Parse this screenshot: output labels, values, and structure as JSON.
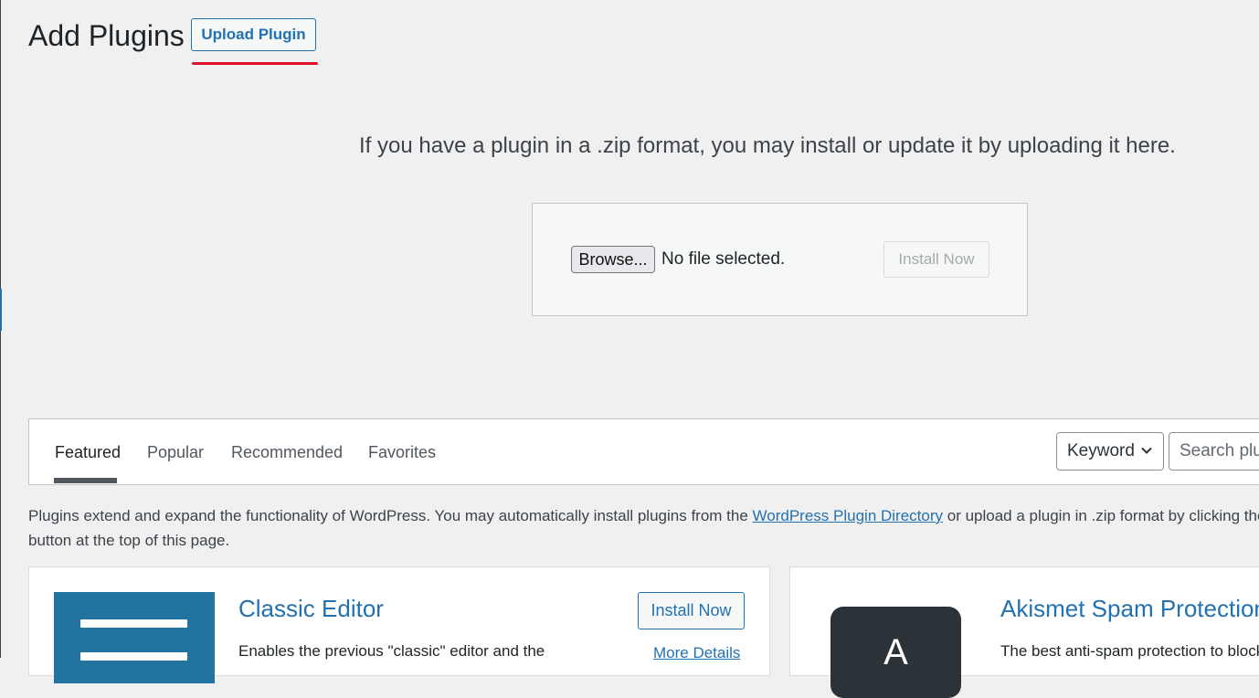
{
  "header": {
    "title": "Add Plugins",
    "upload_button": "Upload Plugin"
  },
  "upload": {
    "help_text": "If you have a plugin in a .zip format, you may install or update it by uploading it here.",
    "browse_button": "Browse...",
    "file_status": "No file selected.",
    "install_button": "Install Now"
  },
  "filter": {
    "tabs": [
      {
        "label": "Featured",
        "active": true
      },
      {
        "label": "Popular",
        "active": false
      },
      {
        "label": "Recommended",
        "active": false
      },
      {
        "label": "Favorites",
        "active": false
      }
    ],
    "search_type": "Keyword",
    "search_placeholder": "Search plugins..."
  },
  "intro": {
    "text_before": "Plugins extend and expand the functionality of WordPress. You may automatically install plugins from the ",
    "link": "WordPress Plugin Directory",
    "text_after": " or upload a plugin in .zip format by clicking the button at the top of this page."
  },
  "plugins": [
    {
      "name": "Classic Editor",
      "description": "Enables the previous \"classic\" editor and the",
      "install_label": "Install Now",
      "more_details": "More Details"
    },
    {
      "name": "Akismet Spam Protection",
      "description": "The best anti-spam protection to block",
      "icon_letter": "A"
    }
  ],
  "colors": {
    "accent": "#2271b1",
    "highlight_underline": "#e0112b",
    "background": "#f0f0f1"
  }
}
